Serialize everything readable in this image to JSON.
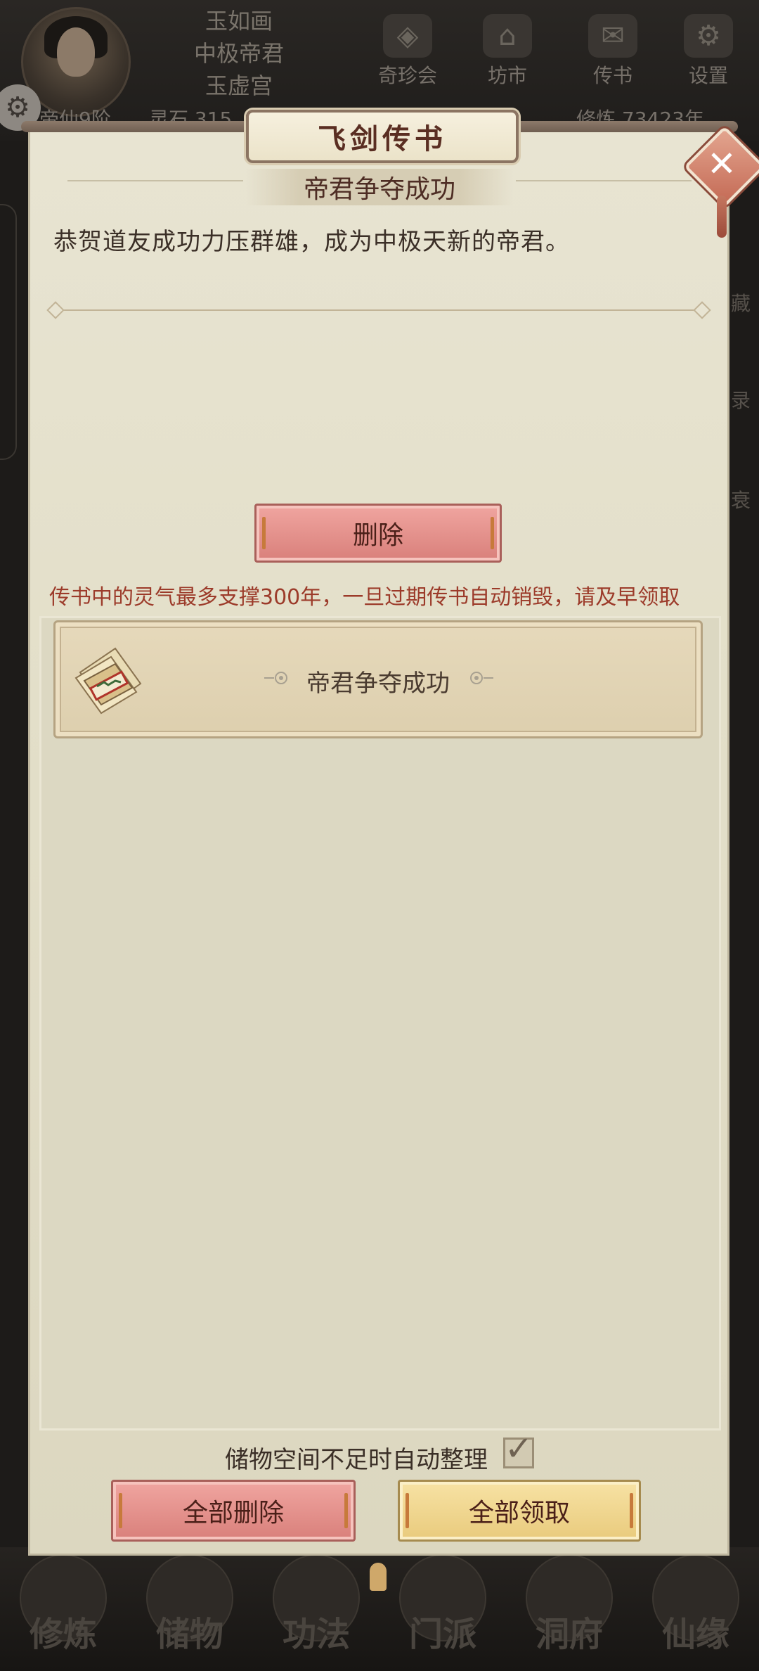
{
  "background": {
    "names": [
      "玉如画",
      "中极帝君",
      "玉虚宫"
    ],
    "nav": [
      {
        "label": "奇珍会",
        "icon": "treasure-icon"
      },
      {
        "label": "坊市",
        "icon": "market-icon"
      },
      {
        "label": "传书",
        "icon": "letter-icon"
      },
      {
        "label": "设置",
        "icon": "gear-icon"
      }
    ],
    "rank": "帝仙9阶",
    "stone": "灵石 315",
    "cultivation": "修炼 73423年",
    "side_labels": [
      "藏",
      "录",
      "衰"
    ],
    "bottom_tabs": [
      "修炼",
      "储物",
      "功法",
      "门派",
      "洞府",
      "仙缘"
    ]
  },
  "modal": {
    "title": "飞剑传书",
    "message_title": "帝君争夺成功",
    "message_body": "恭贺道友成功力压群雄，成为中极天新的帝君。",
    "delete_label": "删除",
    "warning": "传书中的灵气最多支撑300年，一旦过期传书自动销毁，请及早领取",
    "list": [
      {
        "title": "帝君争夺成功",
        "icon": "scroll-letter-icon"
      }
    ],
    "auto_sort_label": "储物空间不足时自动整理",
    "auto_sort_checked": true,
    "delete_all_label": "全部删除",
    "claim_all_label": "全部领取"
  }
}
